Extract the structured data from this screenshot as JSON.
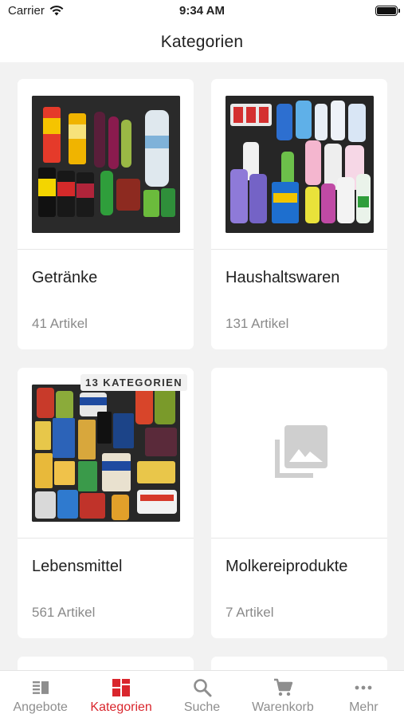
{
  "status": {
    "carrier": "Carrier",
    "time": "9:34 AM"
  },
  "header": {
    "title": "Kategorien"
  },
  "categories": [
    {
      "name": "Getränke",
      "count": "41 Artikel"
    },
    {
      "name": "Haushaltswaren",
      "count": "131 Artikel"
    },
    {
      "name": "Lebensmittel",
      "count": "561 Artikel",
      "badge": "13 KATEGORIEN"
    },
    {
      "name": "Molkereiprodukte",
      "count": "7 Artikel"
    }
  ],
  "tabs": [
    {
      "label": "Angebote",
      "icon": "offers-icon"
    },
    {
      "label": "Kategorien",
      "icon": "categories-icon",
      "active": true
    },
    {
      "label": "Suche",
      "icon": "search-icon"
    },
    {
      "label": "Warenkorb",
      "icon": "cart-icon"
    },
    {
      "label": "Mehr",
      "icon": "more-icon"
    }
  ],
  "colors": {
    "accent": "#d9262d",
    "inactive": "#8e8e8e",
    "background": "#f2f2f2"
  }
}
